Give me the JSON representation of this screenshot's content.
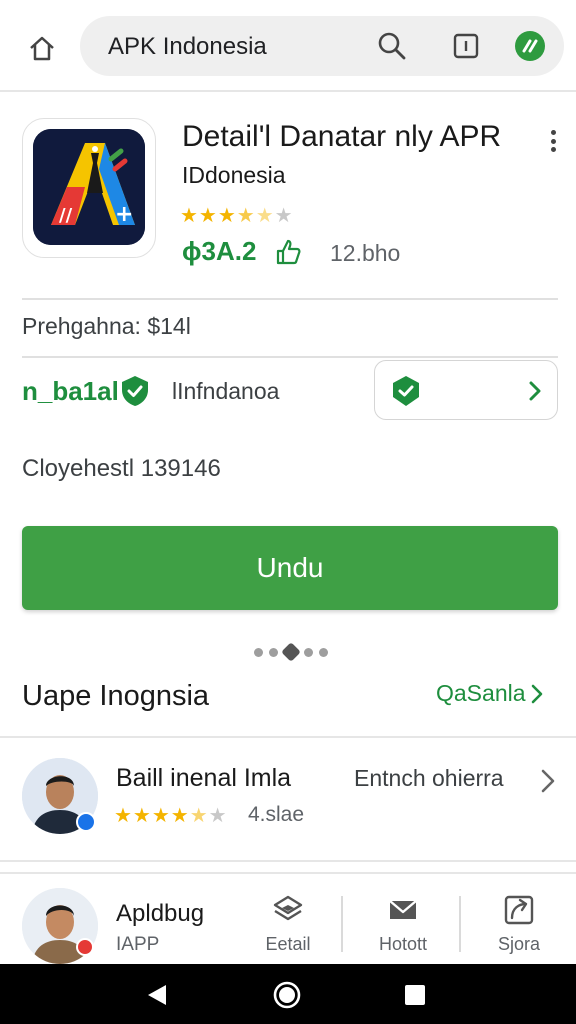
{
  "browser": {
    "url_text": "APK Indonesia",
    "icons": [
      "home-icon",
      "search-icon",
      "tab-switcher-icon",
      "extension-icon"
    ]
  },
  "app": {
    "title": "Detail'l Danatar nly APR",
    "developer": "IDdonesia",
    "rating_stars": 3.5,
    "rating_display": "★★★★★",
    "price_score": "ϕ3A.2",
    "size": "12.bho"
  },
  "details": {
    "price_line": "Prehgahna: $14l",
    "badge_label": "n_ba1al",
    "badge_text": "lInfndanoa",
    "checksum": "Cloyehestl  139146"
  },
  "actions": {
    "download_label": "Undu"
  },
  "section": {
    "title": "Uape Inognsia",
    "link_label": "QaSanla"
  },
  "review": {
    "name": "Baill inenal Imla",
    "stars": 4.5,
    "size": "4.slae",
    "action": "Entnch ohierra"
  },
  "bottom_nav": {
    "profile_name": "Apldbug",
    "profile_sub": "IAPP",
    "items": [
      {
        "label": "Eetail",
        "icon": "layers-icon"
      },
      {
        "label": "Hotott",
        "icon": "mail-icon"
      },
      {
        "label": "Sjora",
        "icon": "share-icon"
      }
    ]
  },
  "colors": {
    "accent_green": "#1e8e3e",
    "download_green": "#3fa045",
    "star": "#f4b400"
  }
}
